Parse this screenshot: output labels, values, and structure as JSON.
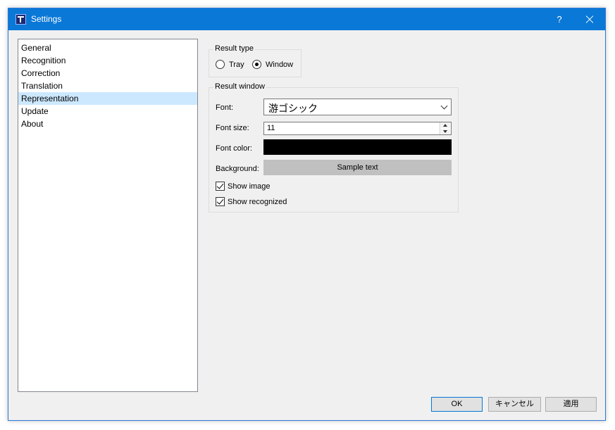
{
  "window": {
    "title": "Settings",
    "help_label": "?",
    "accent_color": "#0a78d7"
  },
  "sidebar": {
    "items": [
      {
        "label": "General"
      },
      {
        "label": "Recognition"
      },
      {
        "label": "Correction"
      },
      {
        "label": "Translation"
      },
      {
        "label": "Representation",
        "selected": true
      },
      {
        "label": "Update"
      },
      {
        "label": "About"
      }
    ]
  },
  "result_type": {
    "legend": "Result type",
    "options": [
      {
        "label": "Tray",
        "checked": false
      },
      {
        "label": "Window",
        "checked": true
      }
    ]
  },
  "result_window": {
    "legend": "Result window",
    "font_label": "Font:",
    "font_value": "游ゴシック",
    "font_size_label": "Font size:",
    "font_size_value": "11",
    "font_color_label": "Font color:",
    "font_color_value": "#000000",
    "background_label": "Background:",
    "background_color": "#c0c0c0",
    "sample_text": "Sample text",
    "show_image_label": "Show image",
    "show_image_checked": true,
    "show_recognized_label": "Show recognized",
    "show_recognized_checked": true
  },
  "buttons": {
    "ok": "OK",
    "cancel": "キャンセル",
    "apply": "適用"
  }
}
